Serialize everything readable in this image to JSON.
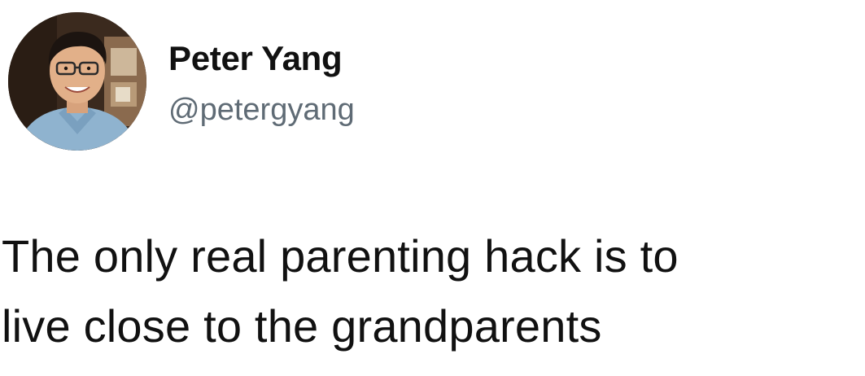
{
  "tweet": {
    "author": {
      "display_name": "Peter Yang",
      "handle": "@petergyang",
      "avatar_icon": "profile-photo"
    },
    "text_lines": [
      "The only real parenting hack is to",
      "live close to the grandparents"
    ]
  },
  "colors": {
    "background": "#ffffff",
    "text": "#111111",
    "handle": "#5f6b75"
  }
}
